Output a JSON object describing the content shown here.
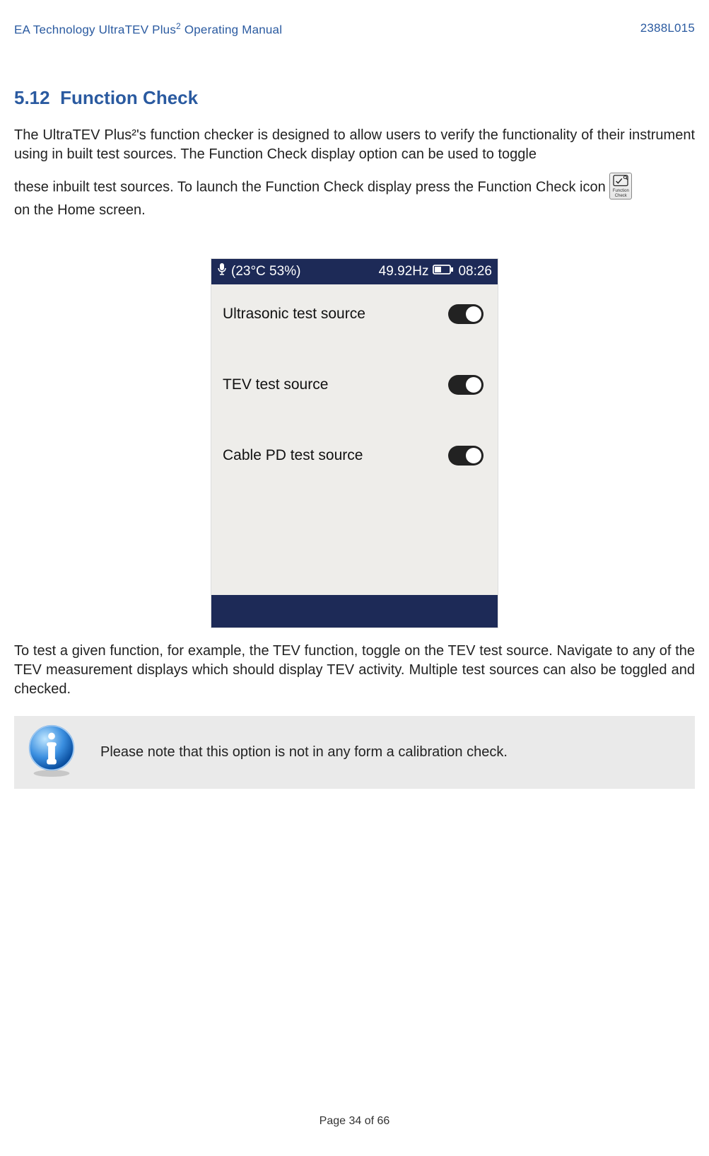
{
  "header": {
    "left": "EA Technology UltraTEV Plus",
    "left_sup": "2",
    "left_tail": " Operating Manual",
    "right": "2388L015"
  },
  "section": {
    "number": "5.12",
    "title": "Function Check"
  },
  "para1": "The UltraTEV Plus²'s function checker is designed to allow users to verify the functionality of their instrument using in built test sources. The Function Check display option can be used to toggle",
  "para1_tail_a": "these inbuilt test sources. To launch the Function Check display press the Function Check icon",
  "para1_tail_b": "on the Home screen.",
  "fc_icon_caption_line1": "Function",
  "fc_icon_caption_line2": "Check",
  "device": {
    "statusbar": {
      "temp_pct": "(23°C  53%)",
      "freq": "49.92Hz",
      "time": "08:26"
    },
    "rows": [
      {
        "label": "Ultrasonic test source",
        "on": false
      },
      {
        "label": "TEV test source",
        "on": false
      },
      {
        "label": "Cable PD test source",
        "on": false
      }
    ]
  },
  "para2": "To test a given function, for example, the TEV function, toggle on the TEV test source. Navigate to any of the TEV measurement displays which should display TEV activity. Multiple test sources can also be toggled and checked.",
  "note": "Please note that this option is not in any form a calibration check.",
  "footer": "Page 34 of 66"
}
